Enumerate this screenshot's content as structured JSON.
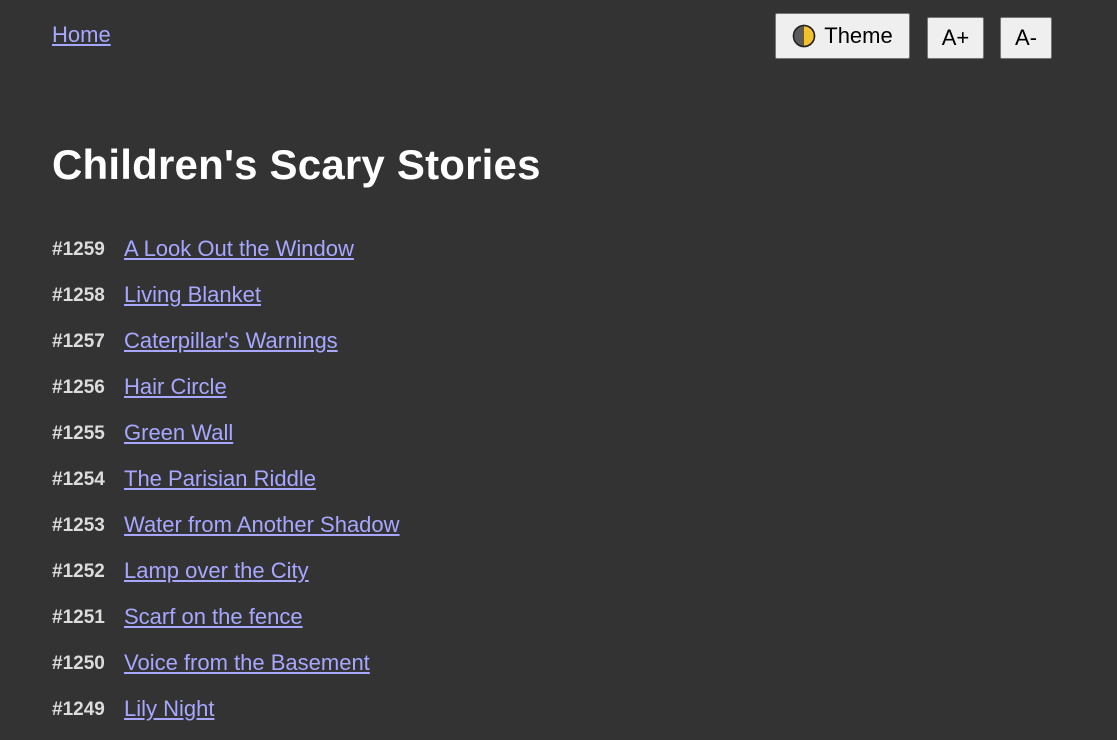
{
  "nav": {
    "home_label": "Home"
  },
  "toolbar": {
    "theme_label": "Theme",
    "theme_icon": "half-moon-icon",
    "font_increase_label": "A+",
    "font_decrease_label": "A-"
  },
  "page": {
    "title": "Children's Scary Stories"
  },
  "stories": [
    {
      "number": "#1259",
      "title": "A Look Out the Window"
    },
    {
      "number": "#1258",
      "title": "Living Blanket"
    },
    {
      "number": "#1257",
      "title": "Caterpillar's Warnings"
    },
    {
      "number": "#1256",
      "title": "Hair Circle"
    },
    {
      "number": "#1255",
      "title": "Green Wall"
    },
    {
      "number": "#1254",
      "title": "The Parisian Riddle"
    },
    {
      "number": "#1253",
      "title": "Water from Another Shadow"
    },
    {
      "number": "#1252",
      "title": "Lamp over the City"
    },
    {
      "number": "#1251",
      "title": "Scarf on the fence"
    },
    {
      "number": "#1250",
      "title": "Voice from the Basement"
    },
    {
      "number": "#1249",
      "title": "Lily Night"
    }
  ],
  "colors": {
    "background": "#333333",
    "link": "#a7a7ff",
    "title": "#ffffff",
    "button_bg": "#efefef",
    "icon_yellow": "#f2c12e"
  }
}
